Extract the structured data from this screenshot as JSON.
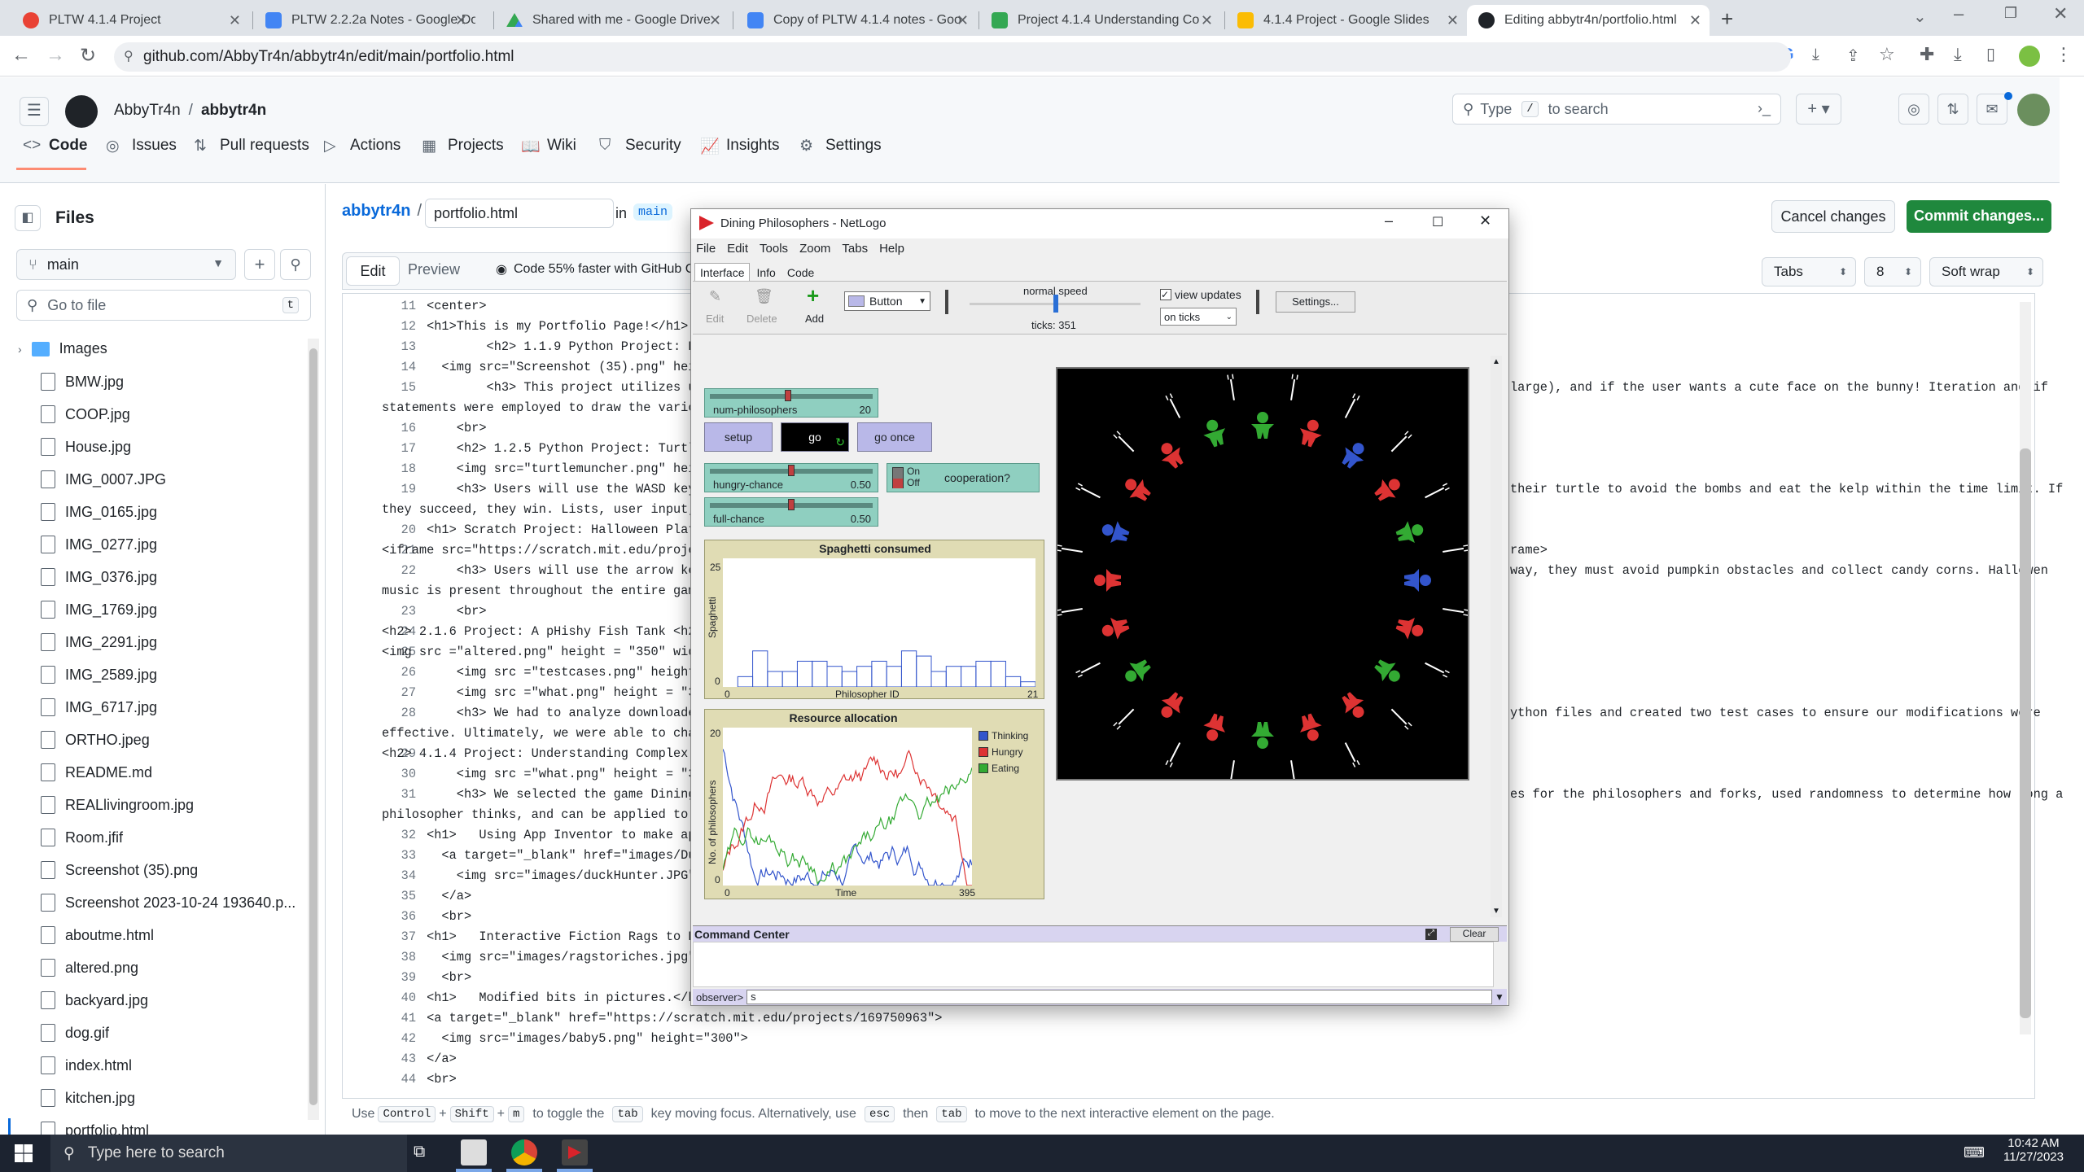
{
  "browser": {
    "tabs": [
      {
        "title": "PLTW 4.1.4 Project",
        "color": "#e94235"
      },
      {
        "title": "PLTW 2.2.2a Notes - Google Do",
        "color": "#4285f4"
      },
      {
        "title": "Shared with me - Google Drive",
        "color": "#34a853"
      },
      {
        "title": "Copy of PLTW 4.1.4 notes - Goo",
        "color": "#4285f4"
      },
      {
        "title": "Project 4.1.4 Understanding Co",
        "color": "#34a853"
      },
      {
        "title": "4.1.4 Project - Google Slides",
        "color": "#fbbc04"
      },
      {
        "title": "Editing abbytr4n/portfolio.html",
        "color": "#1f2328"
      }
    ],
    "url": "github.com/AbbyTr4n/abbytr4n/edit/main/portfolio.html"
  },
  "github": {
    "owner": "AbbyTr4n",
    "separator": "/",
    "repo": "abbytr4n",
    "search_placeholder_pre": "Type",
    "search_key": "/",
    "search_placeholder_post": "to search",
    "nav": [
      "Code",
      "Issues",
      "Pull requests",
      "Actions",
      "Projects",
      "Wiki",
      "Security",
      "Insights",
      "Settings"
    ]
  },
  "files": {
    "title": "Files",
    "branch": "main",
    "goto_placeholder": "Go to file",
    "goto_key": "t",
    "folder": "Images",
    "items": [
      "BMW.jpg",
      "COOP.jpg",
      "House.jpg",
      "IMG_0007.JPG",
      "IMG_0165.jpg",
      "IMG_0277.jpg",
      "IMG_0376.jpg",
      "IMG_1769.jpg",
      "IMG_2291.jpg",
      "IMG_2589.jpg",
      "IMG_6717.jpg",
      "ORTHO.jpeg",
      "README.md",
      "REALlivingroom.jpg",
      "Room.jfif",
      "Screenshot (35).png",
      "Screenshot 2023-10-24 193640.p...",
      "aboutme.html",
      "altered.png",
      "backyard.jpg",
      "dog.gif",
      "index.html",
      "kitchen.jpg",
      "portfolio.html"
    ]
  },
  "editor": {
    "repo_crumb": "abbytr4n",
    "crumb_sep": "/",
    "filename": "portfolio.html",
    "in_label": "in",
    "branch": "main",
    "cancel": "Cancel changes",
    "commit": "Commit changes...",
    "tab_edit": "Edit",
    "tab_preview": "Preview",
    "copilot": "Code 55% faster with GitHub Co",
    "indent_mode": "Tabs",
    "indent_size": "8",
    "wrap": "Soft wrap",
    "lines": [
      {
        "n": "11",
        "c": "      <center>"
      },
      {
        "n": "12",
        "c": "      <h1>This is my Portfolio Page!</h1>"
      },
      {
        "n": "13",
        "c": "              <h2> 1.1.9 Python Project: Bui"
      },
      {
        "n": "14",
        "c": "        <img src=\"Screenshot (35).png\" heigh"
      },
      {
        "n": "15",
        "c": "              <h3> This project utilizes use",
        "tail": "large), and if the user wants a cute face on the bunny! Iteration and if"
      },
      {
        "n": "",
        "c": "statements were employed to draw the vario"
      },
      {
        "n": "16",
        "c": "          <br>"
      },
      {
        "n": "17",
        "c": "          <h2> 1.2.5 Python Project: Turtle "
      },
      {
        "n": "18",
        "c": "          <img src=\"turtlemuncher.png\" heigh"
      },
      {
        "n": "19",
        "c": "          <h3> Users will use the WASD keys ",
        "tail": "their turtle to avoid the bombs and eat the kelp within the time limit. If"
      },
      {
        "n": "",
        "c": "they succeed, they win. Lists, user input,"
      },
      {
        "n": "20",
        "c": "      <h1> Scratch Project: Halloween Platfo"
      },
      {
        "n": "21",
        "c": "<iframe src=\"https://scratch.mit.edu/proje",
        "tail": "rame>"
      },
      {
        "n": "22",
        "c": "          <h3> Users will use the arrow keys ",
        "tail": "way, they must avoid pumpkin obstacles and collect candy corns. Hallowen"
      },
      {
        "n": "",
        "c": "music is present throughout the entire gam"
      },
      {
        "n": "23",
        "c": "          <br>"
      },
      {
        "n": "24",
        "c": "<h2> 2.1.6 Project: A pHishy Fish Tank <h2"
      },
      {
        "n": "25",
        "c": "<img src =\"altered.png\" height = \"350\" wid"
      },
      {
        "n": "26",
        "c": "          <img src =\"testcases.png\" height ="
      },
      {
        "n": "27",
        "c": "          <img src =\"what.png\" height = \"350"
      },
      {
        "n": "28",
        "c": "          <h3> We had to analyze downloaded ",
        "tail": "ython files and created two test cases to ensure our modifications were"
      },
      {
        "n": "",
        "c": "effective. Ultimately, we were able to cha"
      },
      {
        "n": "29",
        "c": "<h2> 4.1.4 Project: Understanding Complex "
      },
      {
        "n": "30",
        "c": "          <img src =\"what.png\" height = \"350"
      },
      {
        "n": "31",
        "c": "          <h3> We selected the game Dining P",
        "tail": "es for the philosophers and forks, used randomness to determine how long a"
      },
      {
        "n": "",
        "c": "philosopher thinks, and can be applied to "
      },
      {
        "n": "32",
        "c": "      <h1>   Using App Inventor to make app "
      },
      {
        "n": "33",
        "c": "        <a target=\"_blank\" href=\"images/Duck"
      },
      {
        "n": "34",
        "c": "          <img src=\"images/duckHunter.JPG\" h"
      },
      {
        "n": "35",
        "c": "        </a>"
      },
      {
        "n": "36",
        "c": "        <br>"
      },
      {
        "n": "37",
        "c": "      <h1>   Interactive Fiction Rags to Ric"
      },
      {
        "n": "38",
        "c": "        <img src=\"images/ragstoriches.jpg\" h"
      },
      {
        "n": "39",
        "c": "        <br>"
      },
      {
        "n": "40",
        "c": "      <h1>   Modified bits in pictures.</h1>"
      },
      {
        "n": "41",
        "c": "      <a target=\"_blank\" href=\"https://scratch.mit.edu/projects/169750963\">"
      },
      {
        "n": "42",
        "c": "        <img src=\"images/baby5.png\" height=\"300\">"
      },
      {
        "n": "43",
        "c": "      </a>"
      },
      {
        "n": "44",
        "c": "      <br>"
      }
    ],
    "status_use": "Use",
    "status_k1": "Control",
    "status_plus1": "+",
    "status_k2": "Shift",
    "status_plus2": "+",
    "status_k3": "m",
    "status_mid": "to toggle the",
    "status_k4": "tab",
    "status_rest": "key moving focus. Alternatively, use",
    "status_k5": "esc",
    "status_then": "then",
    "status_k6": "tab",
    "status_end": "to move to the next interactive element on the page."
  },
  "netlogo": {
    "title": "Dining Philosophers - NetLogo",
    "menu": [
      "File",
      "Edit",
      "Tools",
      "Zoom",
      "Tabs",
      "Help"
    ],
    "tabs": [
      "Interface",
      "Info",
      "Code"
    ],
    "toolbar": {
      "edit": "Edit",
      "delete": "Delete",
      "add": "Add",
      "widget": "Button",
      "speed": "normal speed",
      "ticks": "ticks: 351",
      "view_updates": "view updates",
      "update_mode": "on ticks",
      "settings": "Settings..."
    },
    "sliders": [
      {
        "label": "num-philosophers",
        "value": "20",
        "fill": 0.5
      },
      {
        "label": "hungry-chance",
        "value": "0.50",
        "fill": 0.5
      },
      {
        "label": "full-chance",
        "value": "0.50",
        "fill": 0.5
      }
    ],
    "buttons": {
      "setup": "setup",
      "go": "go",
      "go_once": "go once"
    },
    "switch": {
      "on": "On",
      "off": "Off",
      "label": "cooperation?"
    },
    "plot1": {
      "title": "Spaghetti consumed",
      "ylabel": "Spaghetti",
      "xlabel": "Philosopher ID",
      "ymax": "25",
      "ymin": "0",
      "xmin": "0",
      "xmax": "21"
    },
    "plot2": {
      "title": "Resource allocation",
      "ylabel": "No. of philosophers",
      "xlabel": "Time",
      "ymax": "20",
      "ymin": "0",
      "xmin": "0",
      "xmax": "395",
      "legend": [
        "Thinking",
        "Hungry",
        "Eating"
      ]
    },
    "command_center": {
      "title": "Command Center",
      "clear": "Clear",
      "prompt": "observer>",
      "input": "s"
    }
  },
  "taskbar": {
    "search": "Type here to search",
    "time": "10:42 AM",
    "date": "11/27/2023"
  },
  "colors": {
    "commit": "#1f883d",
    "netlogo_bg": "#000000",
    "thinking": "#3355cc",
    "hungry": "#dd3333",
    "eating": "#33aa33"
  }
}
